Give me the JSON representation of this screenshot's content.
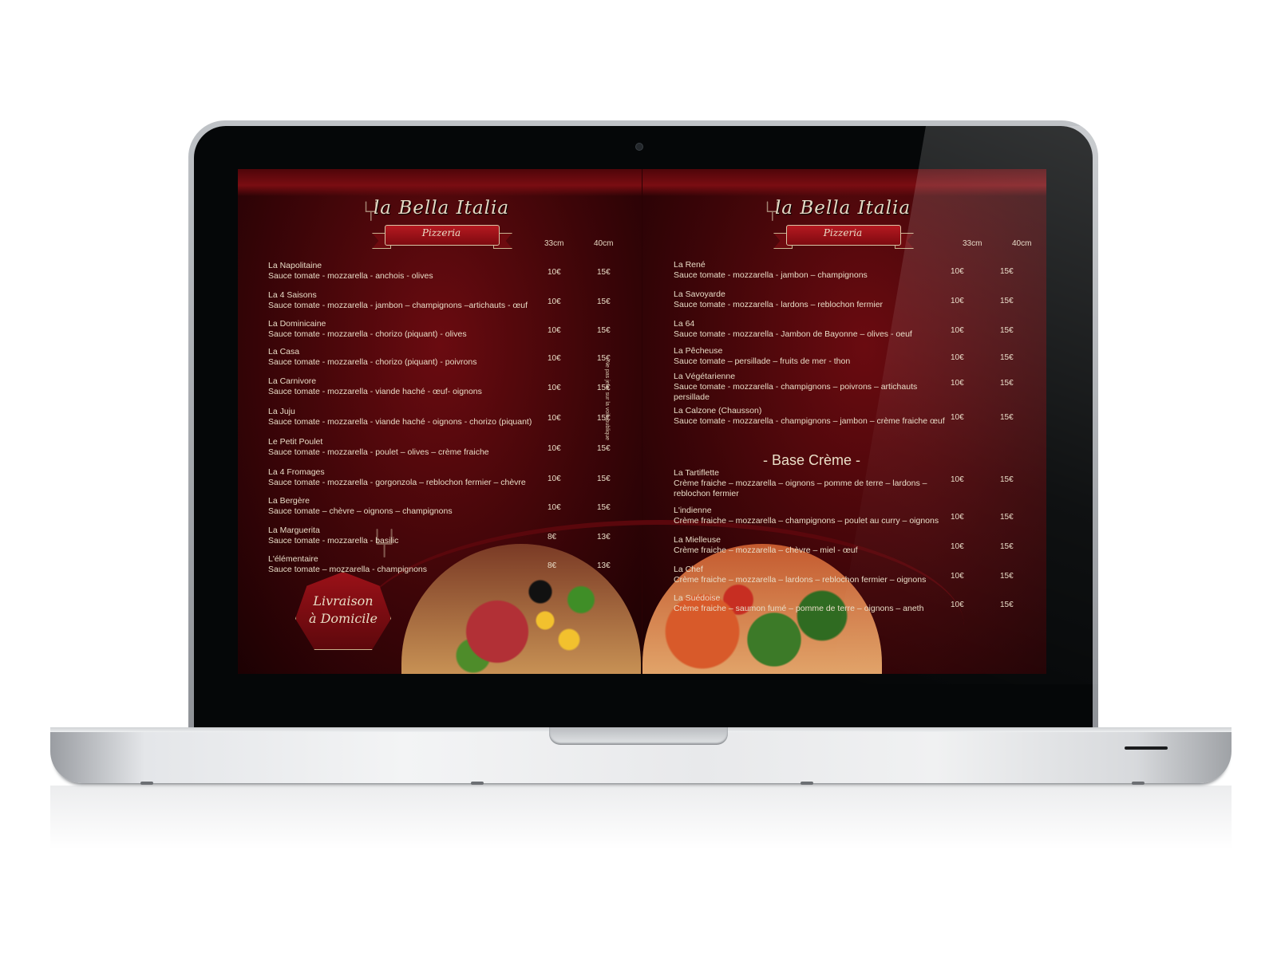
{
  "brand": {
    "title": "la Bella Italia",
    "subtitle": "Pizzeria"
  },
  "columns": {
    "small": "33cm",
    "large": "40cm"
  },
  "left_items": [
    {
      "name": "La Napolitaine",
      "desc": "Sauce tomate -  mozzarella  - anchois - olives",
      "p33": "10€",
      "p40": "15€"
    },
    {
      "name": "La 4 Saisons",
      "desc": "Sauce tomate - mozzarella  - jambon – champignons –artichauts - œuf",
      "p33": "10€",
      "p40": "15€"
    },
    {
      "name": "La Dominicaine",
      "desc": "Sauce tomate - mozzarella  - chorizo (piquant) - olives",
      "p33": "10€",
      "p40": "15€"
    },
    {
      "name": "La Casa",
      "desc": "Sauce tomate - mozzarella  - chorizo (piquant) - poivrons",
      "p33": "10€",
      "p40": "15€"
    },
    {
      "name": "La Carnivore",
      "desc": "Sauce tomate - mozzarella  - viande haché - œuf- oignons",
      "p33": "10€",
      "p40": "15€"
    },
    {
      "name": "La Juju",
      "desc": "Sauce tomate - mozzarella  - viande haché - oignons -  chorizo (piquant)",
      "p33": "10€",
      "p40": "15€"
    },
    {
      "name": "Le Petit Poulet",
      "desc": "Sauce tomate - mozzarella  - poulet – olives – crème fraiche",
      "p33": "10€",
      "p40": "15€"
    },
    {
      "name": "La 4 Fromages",
      "desc": "Sauce tomate - mozzarella  - gorgonzola – reblochon fermier – chèvre",
      "p33": "10€",
      "p40": "15€"
    },
    {
      "name": "La Bergère",
      "desc": "Sauce tomate – chèvre – oignons – champignons",
      "p33": "10€",
      "p40": "15€"
    },
    {
      "name": "La Marguerita",
      "desc": "Sauce tomate - mozzarella - basilic",
      "p33": "8€",
      "p40": "13€"
    },
    {
      "name": "L'élémentaire",
      "desc": "Sauce tomate – mozzarella - champignons",
      "p33": "8€",
      "p40": "13€"
    }
  ],
  "right_items": [
    {
      "name": "La René",
      "desc": "Sauce tomate - mozzarella  - jambon – champignons",
      "p33": "10€",
      "p40": "15€"
    },
    {
      "name": "La Savoyarde",
      "desc": "Sauce tomate - mozzarella  - lardons – reblochon fermier",
      "p33": "10€",
      "p40": "15€"
    },
    {
      "name": "La 64",
      "desc": "Sauce tomate - mozzarella  - Jambon de Bayonne – olives - oeuf",
      "p33": "10€",
      "p40": "15€"
    },
    {
      "name": "La Pêcheuse",
      "desc": "Sauce tomate – persillade – fruits de mer - thon",
      "p33": "10€",
      "p40": "15€"
    },
    {
      "name": "La Végétarienne",
      "desc": "Sauce tomate - mozzarella  - champignons – poivrons – artichauts persillade",
      "p33": "10€",
      "p40": "15€"
    },
    {
      "name": "La Calzone (Chausson)",
      "desc": "Sauce tomate - mozzarella  - champignons – jambon – crème fraiche  œuf",
      "p33": "10€",
      "p40": "15€"
    }
  ],
  "section": {
    "title": "- Base Crème -"
  },
  "creme_items": [
    {
      "name": "La Tartiflette",
      "desc": "Crème fraiche – mozzarella – oignons – pomme de terre – lardons – reblochon fermier",
      "p33": "10€",
      "p40": "15€"
    },
    {
      "name": "L'indienne",
      "desc": "Crème fraiche – mozzarella – champignons – poulet au curry – oignons",
      "p33": "10€",
      "p40": "15€"
    },
    {
      "name": "La Mielleuse",
      "desc": "Crème fraiche – mozzarella – chèvre – miel - œuf",
      "p33": "10€",
      "p40": "15€"
    },
    {
      "name": "La Chef",
      "desc": "Crème fraiche – mozzarella – lardons – reblochon fermier – oignons",
      "p33": "10€",
      "p40": "15€"
    },
    {
      "name": "La Suédoise",
      "desc": "Crème fraiche – saumon fumé – pomme de terre – oignons – aneth",
      "p33": "10€",
      "p40": "15€"
    }
  ],
  "badge": {
    "line1": "Livraison",
    "line2": "à Domicile"
  },
  "vertical_note": "Ne pas jeter sur la voie publique"
}
